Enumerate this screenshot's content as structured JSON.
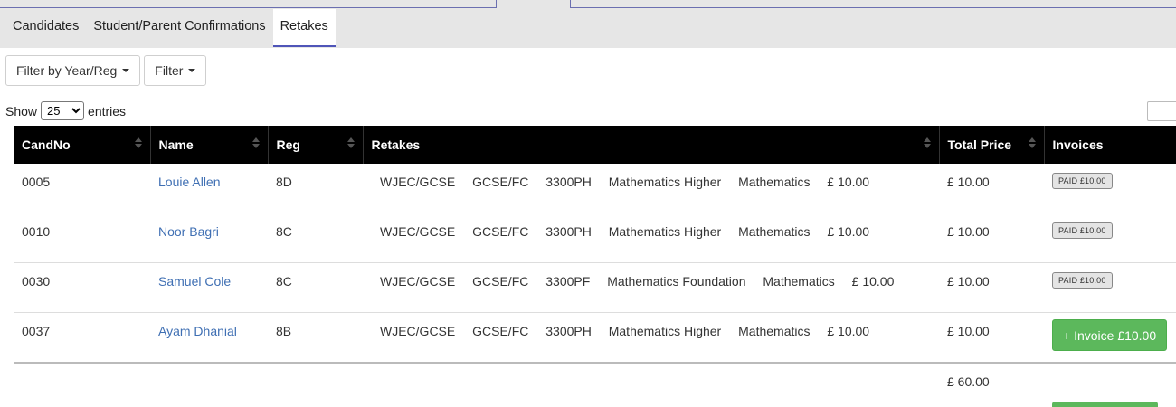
{
  "tabs": [
    {
      "label": "Candidates",
      "active": false
    },
    {
      "label": "Student/Parent Confirmations",
      "active": false
    },
    {
      "label": "Retakes",
      "active": true
    }
  ],
  "filters": {
    "year_reg_label": "Filter by Year/Reg",
    "filter_label": "Filter"
  },
  "length": {
    "show_label": "Show",
    "selected": "25",
    "entries_label": "entries"
  },
  "table": {
    "columns": [
      "CandNo",
      "Name",
      "Reg",
      "Retakes",
      "Total Price",
      "Invoices"
    ],
    "rows": [
      {
        "candno": "0005",
        "name": "Louie Allen",
        "reg": "8D",
        "retake": {
          "board": "WJEC/GCSE",
          "level": "GCSE/FC",
          "code": "3300PH",
          "title": "Mathematics Higher",
          "subject": "Mathematics",
          "price": "£ 10.00"
        },
        "total": "£ 10.00",
        "invoice": "PAID £10.00",
        "invoice_paid": true
      },
      {
        "candno": "0010",
        "name": "Noor Bagri",
        "reg": "8C",
        "retake": {
          "board": "WJEC/GCSE",
          "level": "GCSE/FC",
          "code": "3300PH",
          "title": "Mathematics Higher",
          "subject": "Mathematics",
          "price": "£ 10.00"
        },
        "total": "£ 10.00",
        "invoice": "PAID £10.00",
        "invoice_paid": true
      },
      {
        "candno": "0030",
        "name": "Samuel Cole",
        "reg": "8C",
        "retake": {
          "board": "WJEC/GCSE",
          "level": "GCSE/FC",
          "code": "3300PF",
          "title": "Mathematics Foundation",
          "subject": "Mathematics",
          "price": "£ 10.00"
        },
        "total": "£ 10.00",
        "invoice": "PAID £10.00",
        "invoice_paid": true
      },
      {
        "candno": "0037",
        "name": "Ayam Dhanial",
        "reg": "8B",
        "retake": {
          "board": "WJEC/GCSE",
          "level": "GCSE/FC",
          "code": "3300PH",
          "title": "Mathematics Higher",
          "subject": "Mathematics",
          "price": "£ 10.00"
        },
        "total": "£ 10.00",
        "invoice": "+ Invoice £10.00",
        "invoice_paid": false
      }
    ],
    "grand_total": "£ 60.00"
  },
  "colors": {
    "tab_accent": "#4f55b8",
    "header_bg": "#000000",
    "link": "#3f6fb3",
    "invoice_button": "#5cb85c"
  }
}
